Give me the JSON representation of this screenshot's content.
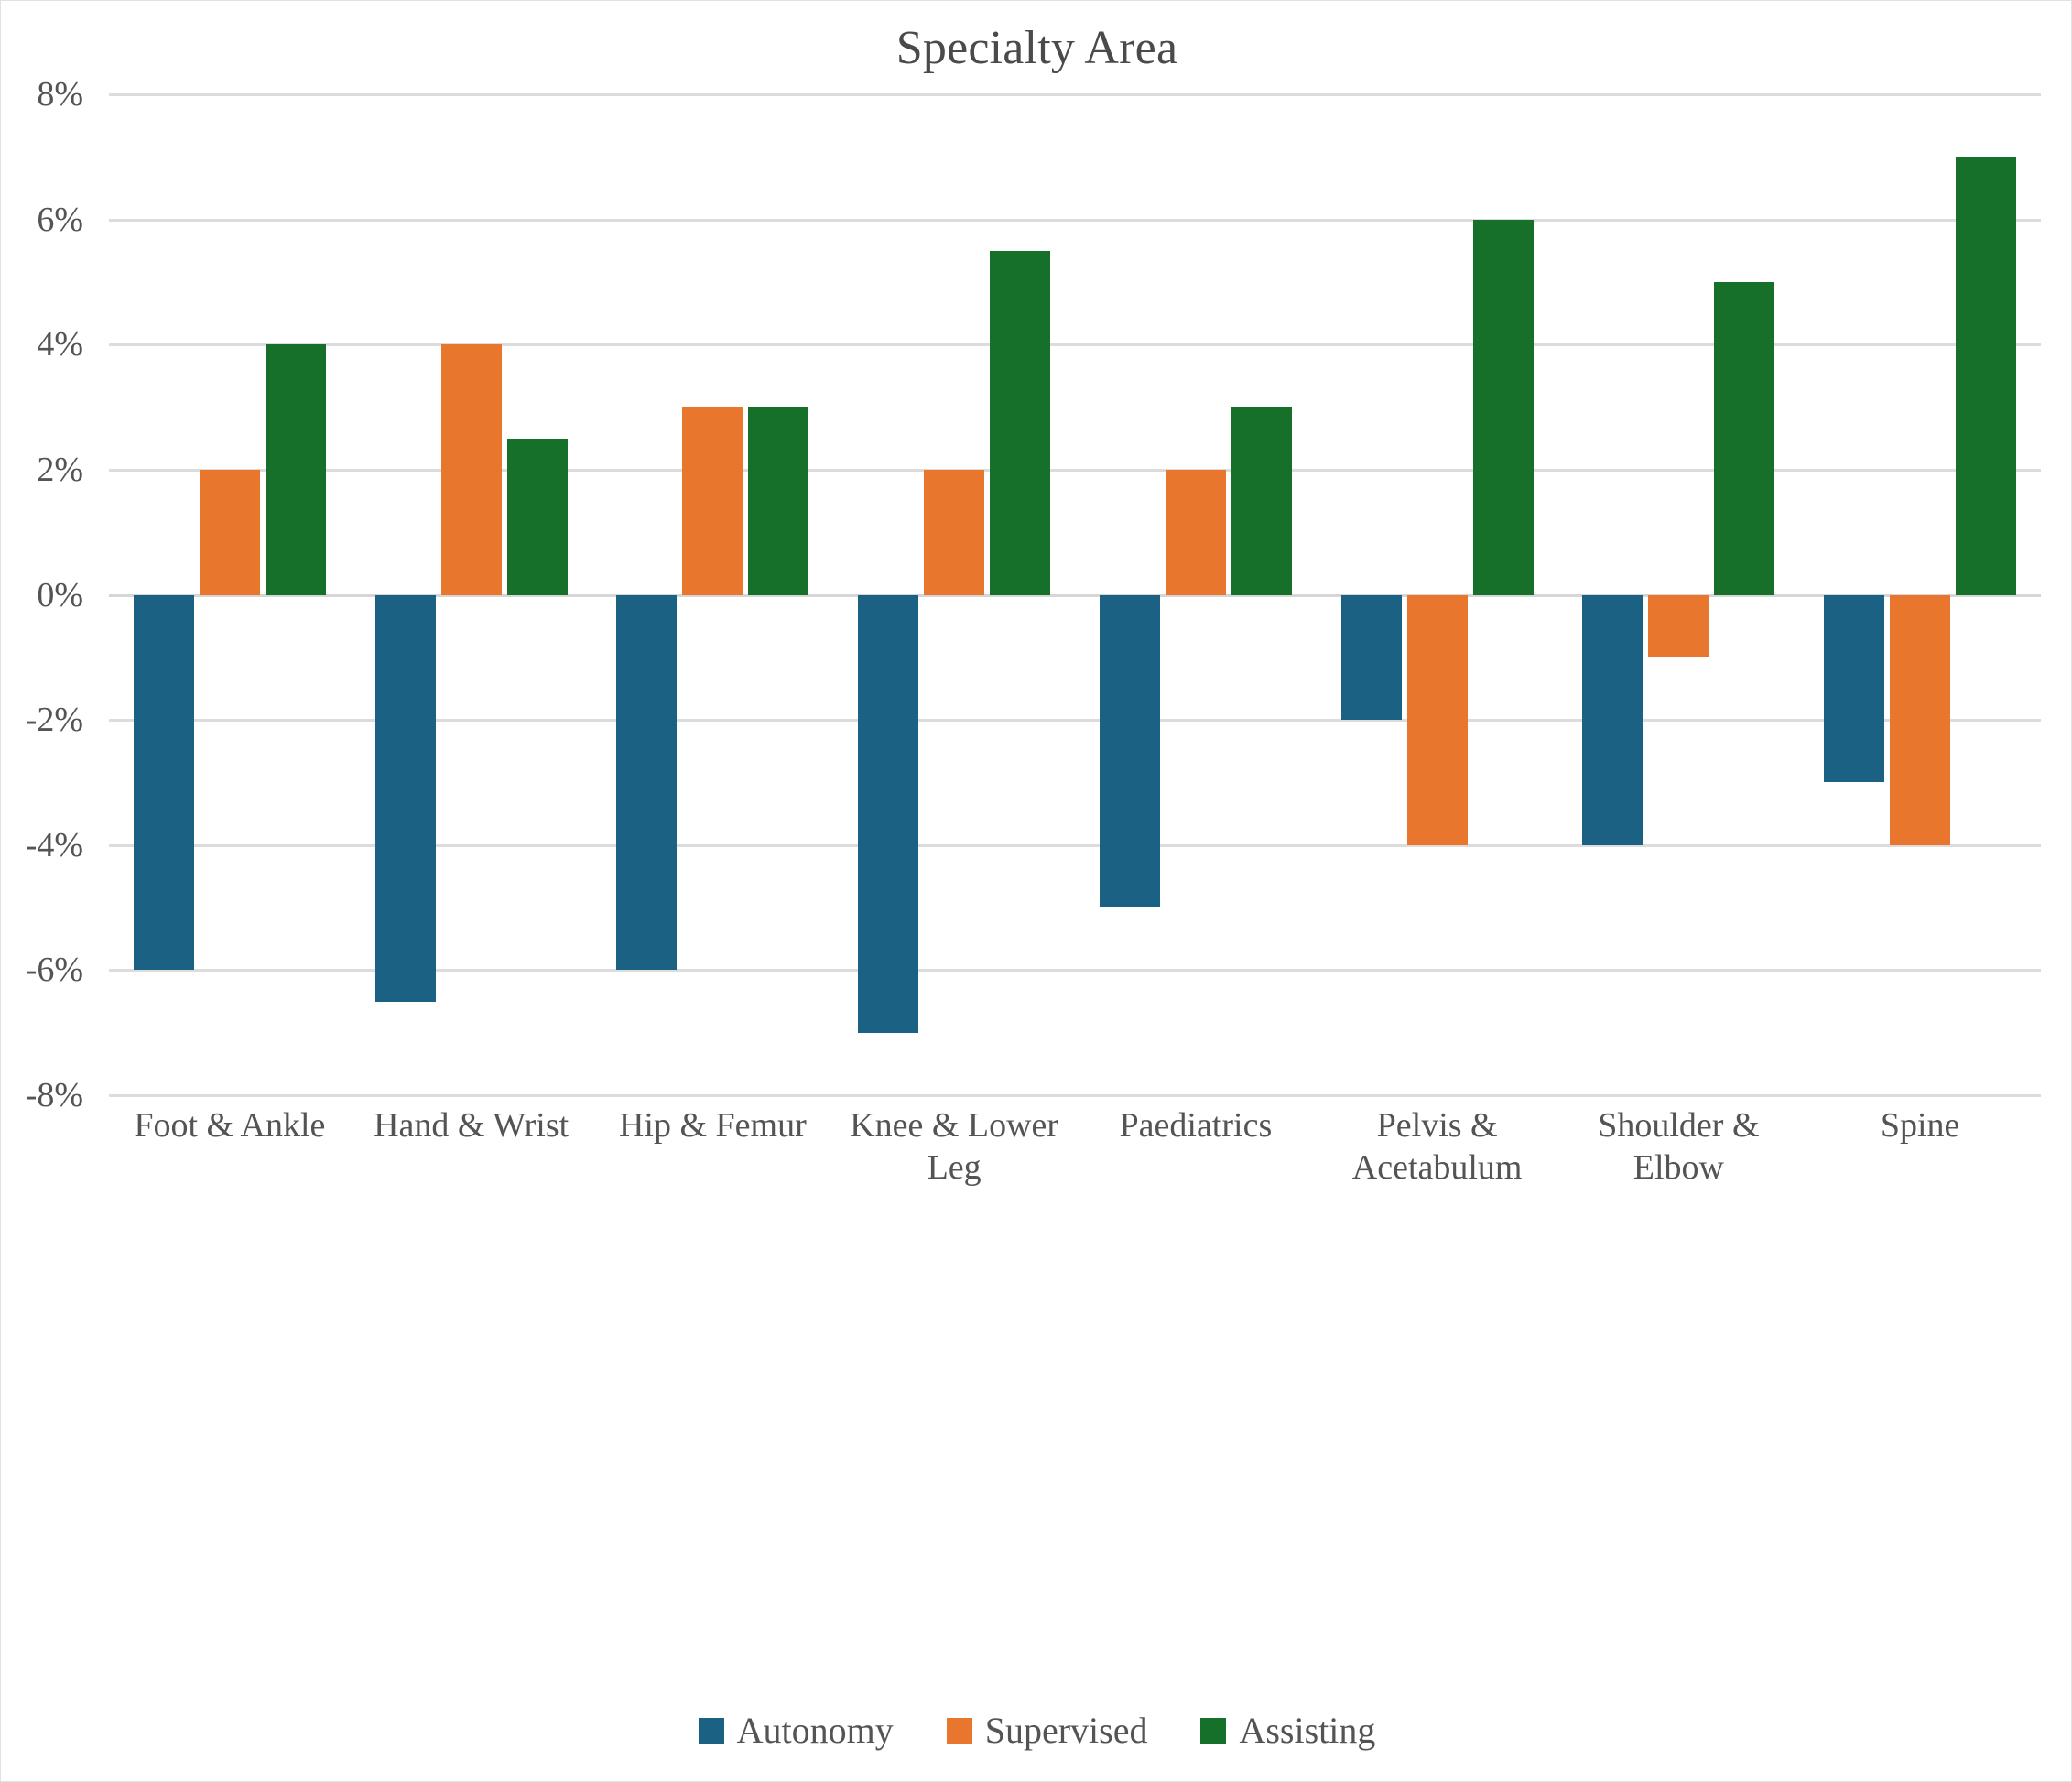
{
  "chart_data": {
    "type": "bar",
    "title": "Specialty Area",
    "xlabel": "",
    "ylabel": "",
    "ylim": [
      -8,
      8
    ],
    "ytick_labels": [
      "8%",
      "6%",
      "4%",
      "2%",
      "0%",
      "-2%",
      "-4%",
      "-6%",
      "-8%"
    ],
    "ytick_values": [
      8,
      6,
      4,
      2,
      0,
      -2,
      -4,
      -6,
      -8
    ],
    "grid": true,
    "legend_position": "bottom",
    "value_unit": "%",
    "categories": [
      "Foot & Ankle",
      "Hand & Wrist",
      "Hip & Femur",
      "Knee & Lower Leg",
      "Paediatrics",
      "Pelvis & Acetabulum",
      "Shoulder & Elbow",
      "Spine"
    ],
    "series": [
      {
        "name": "Autonomy",
        "color": "#1A6183",
        "values": [
          -6,
          -6.5,
          -6,
          -7,
          -5,
          -2,
          -4,
          -3
        ]
      },
      {
        "name": "Supervised",
        "color": "#E8762C",
        "values": [
          2,
          4,
          3,
          2,
          2,
          -4,
          -1,
          -4
        ]
      },
      {
        "name": "Assisting",
        "color": "#17702A",
        "values": [
          4,
          2.5,
          3,
          5.5,
          3,
          6,
          5,
          7
        ]
      }
    ]
  }
}
